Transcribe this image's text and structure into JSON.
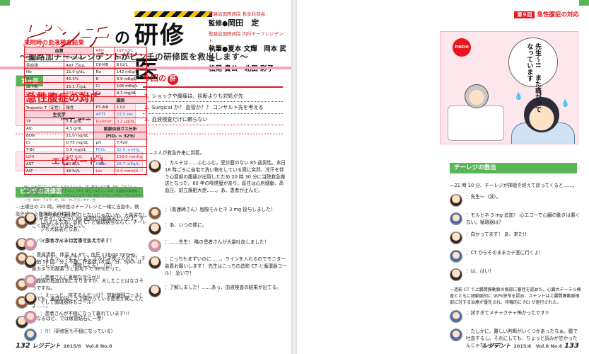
{
  "left": {
    "logo_main": "ピンチ",
    "logo_no": "の",
    "logo_kenshui": "研修医",
    "logo_sub": "～聖路加チーフレジデントがピンチの研修医を救出します～",
    "editors": {
      "supervisor_role": "聖路加国際病院 救急科部長",
      "supervisor_label": "監修●",
      "supervisor_name": "岡田　定",
      "chief_role": "聖路加国際病院 内科チーフレジデント",
      "authors_label": "執筆●",
      "authors_line1": "夏本 文輝　岡本 武士",
      "authors_line2": "松尾 貴公　北田 彩子"
    },
    "chapter": {
      "label": "第９回",
      "title": "急性腹症の対応",
      "author": "岡本 武士"
    },
    "kimo": {
      "heading": "今回の",
      "badge": "肝",
      "points": [
        {
          "n": "1.",
          "text": "ショックや腹痛は、診断よりも対処が先"
        },
        {
          "n": "2.",
          "text": "Surgical か？ 血管か？？ コンサルト先を考える"
        },
        {
          "n": "3.",
          "text": "血液検査だけに頼らない"
        }
      ]
    },
    "episode": "エピソード１",
    "section_title": "ピンチの研修医",
    "time_note": "―土曜日の 21 時。研修医はチーフレジと一緒に当直中。救急外来から腹痛患者の相談あり。",
    "dialogs_left": [
      {
        "avatar": "nurse",
        "text": "：（早歩きしながら）85 歳男性の腹痛みたいだよ。すごく痛がっているらしい。"
      },
      {
        "avatar": "resident",
        "text": "：バイタルサインはどうでしたか？"
      },
      {
        "avatar": "nurse",
        "text": "：意識清明、体温 34.3℃、血圧 118/44 mmHg、脈拍 58 回／分・不整、呼吸数 18 回／分、SpO₂ は鼻カヌラの酸素 3 L 投与下で 98％だって。"
      },
      {
        "avatar": "nurse",
        "text": "：腹痛の程度は気になりますが、大したことはなさそうですね。"
      },
      {
        "avatar": "nurse",
        "text": "：でも、電話の向こうで痛がっている患者が聞こえたよ……。"
      },
      {
        "avatar": "resident",
        "text": "：なるほど、では尿管結石に一票！"
      }
    ],
    "mid_intro": "―２人が救急外来に到着。",
    "dialogs_mid": [
      {
        "avatar": "resident",
        "text": "：カルテは……ふむふむ。受診歴のない 85 歳男性。本日 18 時ごろに自宅で洗い物をしている際に突然、冷汗を伴う心窩部の腹痛が出現したため 20 時 30 分に当院救急搬送となった。60 年の喫煙歴があり、既往は心房細動、高血圧、前立腺肥大症……。あ、患者が止んだ。"
      },
      {
        "avatar": "nurse",
        "text": "：（看護師さん）塩酸モルヒネ 3 mg 投与しました！"
      },
      {
        "avatar": "resident",
        "text": "：あ、いつの間に。"
      },
      {
        "avatar": "pink",
        "text": "：……先生！ 隣の患者さんが大量吐血しました！"
      },
      {
        "avatar": "resident",
        "text": "：こっちもまずいのに……。ラインを入れるのでモニター装着お願いします！ 先生はこっちの造影 CT と循環器コール！ 急いで！"
      },
      {
        "avatar": "resident",
        "text": "：了解しました！……あっ、血液検査の結果が出てる。"
      }
    ],
    "footer": {
      "page": "132",
      "journal": "レジデント",
      "vol": "2015/6　Vol.8 No.6"
    }
  },
  "right": {
    "chapter_tag_label": "第９回",
    "chapter_tag": "急性腹症の対応",
    "lab_title": "来院時の血液検査結果",
    "lab": {
      "headers": [
        "血算",
        "生化学",
        "凝固",
        "動脈血液ガス分析",
        "（FiO₂ ＝ 32％）"
      ],
      "rows": [
        [
          "白血球",
          "6,400/μL",
          "AMY",
          "197 IU/L"
        ],
        [
          "赤血球",
          "497 万/μL",
          "CK",
          "124 IU/L"
        ],
        [
          "Hb",
          "15.0 g/dL",
          "CK-MB",
          "8 IU/L"
        ],
        [
          "Hct",
          "45.3%",
          "Na",
          "142 mEq/L"
        ],
        [
          "血小板",
          "15.1 万/μL",
          "K",
          "3.9 mEq/L"
        ],
        [
          "D-ダイマー",
          "234 mg/dL",
          "Cl",
          "106 mEq/L"
        ],
        [
          "CRP",
          "0.31 mg/dL",
          "Ca",
          "9.1 mg/dL"
        ],
        [
          "Troponin T（定性）",
          "陰性",
          "PT-INR",
          "1.02"
        ],
        [
          "TP",
          "7.6 g/dL",
          "APTT",
          "23.5 sec"
        ],
        [
          "Alb",
          "4.5 g/dL",
          "D-dimer",
          "3.2 μg/dL"
        ],
        [
          "BUN",
          "21.0 mg/dL",
          "pH",
          "7.420"
        ],
        [
          "Cr",
          "0.75 mg/dL",
          "PCO₂",
          "32.6 mmHg"
        ],
        [
          "T-Bil",
          "0.9 mg/dL",
          "PO₂",
          "118.0 mmHg"
        ],
        [
          "LDH",
          "247 IU/L",
          "HCO₃⁻",
          "20.7 mEq/L"
        ],
        [
          "AST",
          "30 IU/L",
          "Lac",
          "2.4 mmol/L"
        ],
        [
          "ALT",
          "18 IU/L",
          "",
          ""
        ]
      ]
    },
    "lab_note": "Hb：ヘモグロビン、Hct：ヘマトクリット、TP：総タンパク量、Alb：アルブミン、BUN：尿素窒素、Cr：クレアチニン、T-Bil：総ビリルビン、LDH：乳酸脱水素酵素、AST：アスパラギン酸アミノトランスフェラーゼ、ALT：アラニンアミノトランスフェラーゼ、AMY：アミラーゼ、CK：クレアチンキナーゼ",
    "dialogs_right1": [
      {
        "avatar": "resident",
        "text": "：やっぱり大したことないじゃないか。大装裟なしいんだよなあ。造影 CT と循環器当なんて、チーレジも大装裟だなあ。"
      },
      {
        "avatar": "pink",
        "text": "：患者さんまた苦痛を訴えてます！"
      },
      {
        "avatar": "resident",
        "text": "：ええっ、うそでしょ？ モルヒネ使ったのに！ チーレジ……あ、押管してる！（泣）"
      },
      {
        "avatar": "pink",
        "text": "：患者さんに著明な冷汗が!!"
      },
      {
        "avatar": "resident",
        "text": "：えーっと、何するんだっけ？ 放射線科コール！ そして循環器科もコール！"
      },
      {
        "avatar": "pink",
        "text": "：患者さんが不穏になって暴れています!!!"
      },
      {
        "avatar": "blue",
        "text": "：!!!（研修医も不穏になっている）"
      }
    ],
    "bubble": "先生〜!!　また痛がって",
    "bubble_b": "なっています",
    "pinchi": "PINCHI",
    "section_title": "チーレジの救出",
    "right2_intro": "―21 時 10 分、チーレジが挿管を終えて戻ってくると……。",
    "dialogs_right2": [
      {
        "avatar": "resident",
        "text": "：先生〜（涙）。"
      },
      {
        "avatar": "blue",
        "text": "：モルヒネ 3 mg 追加！ 心エコーで心臓の動きは悪くない。循環器は？"
      },
      {
        "avatar": "resident",
        "text": "：向かってます！ あ、来た!!"
      },
      {
        "avatar": "blue",
        "text": "：CT からそのままカテ室に行くよ！"
      },
      {
        "avatar": "resident",
        "text": "：は、はい！"
      }
    ],
    "right2_mid": "―造影 CT で上腸間膜動脈の根部に塞栓を認めた。心臓カテーテル検査とともに経動脈的に 99％狭窄を認め、ステントは上腸間膜動脈根部に対する治療が優先され、待機的に PCI が施行された。",
    "dialogs_right3": [
      {
        "avatar": "blue",
        "text": "：試すぎてメチャクチャ怖かったです!!"
      },
      {
        "avatar": "blue",
        "text": "：たしかに、難しい判断がいくつかあったなぁ。腹で吐血するし。それにしても、ちょっと読みが甘かったんじゃないかな？"
      }
    ],
    "footer": {
      "page": "133",
      "journal": "レジデント",
      "vol": "2015/6　Vol.8 No.6"
    }
  }
}
